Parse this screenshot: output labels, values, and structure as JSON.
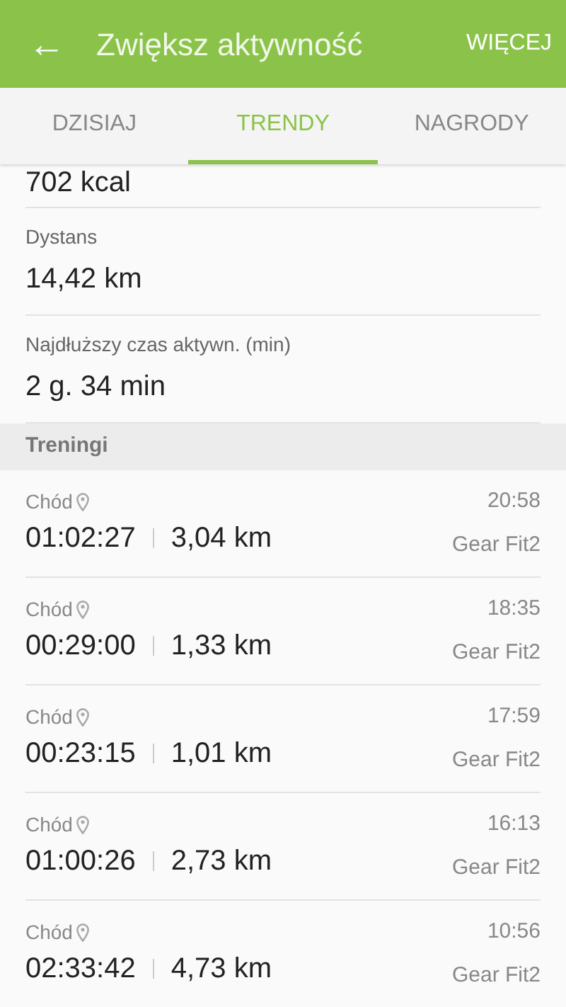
{
  "app_bar": {
    "back": "←",
    "title": "Zwiększ aktywność",
    "action": "WIĘCEJ"
  },
  "tabs": [
    {
      "label": "DZISIAJ",
      "selected": false
    },
    {
      "label": "TRENDY",
      "selected": true
    },
    {
      "label": "NAGRODY",
      "selected": false
    }
  ],
  "partial_value": "702 kcal",
  "stats": [
    {
      "label": "Dystans",
      "value": "14,42 km"
    },
    {
      "label": "Najdłuższy czas aktywn. (min)",
      "value": "2 g. 34 min"
    }
  ],
  "section_title": "Treningi",
  "workouts": [
    {
      "type": "Chód",
      "duration": "01:02:27",
      "distance": "3,04 km",
      "time": "20:58",
      "device": "Gear Fit2"
    },
    {
      "type": "Chód",
      "duration": "00:29:00",
      "distance": "1,33 km",
      "time": "18:35",
      "device": "Gear Fit2"
    },
    {
      "type": "Chód",
      "duration": "00:23:15",
      "distance": "1,01 km",
      "time": "17:59",
      "device": "Gear Fit2"
    },
    {
      "type": "Chód",
      "duration": "01:00:26",
      "distance": "2,73 km",
      "time": "16:13",
      "device": "Gear Fit2"
    },
    {
      "type": "Chód",
      "duration": "02:33:42",
      "distance": "4,73 km",
      "time": "10:56",
      "device": "Gear Fit2"
    }
  ]
}
